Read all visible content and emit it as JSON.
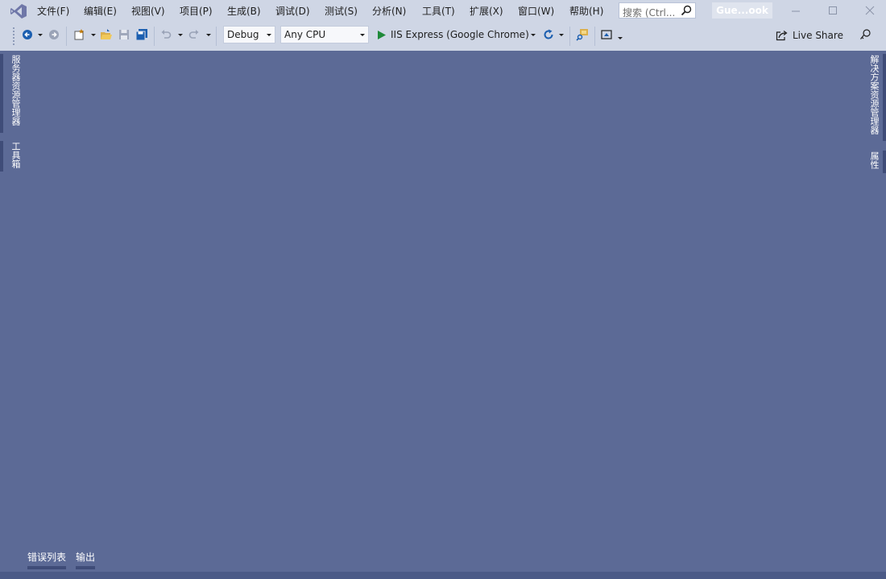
{
  "menu": {
    "items": [
      "文件(F)",
      "编辑(E)",
      "视图(V)",
      "项目(P)",
      "生成(B)",
      "调试(D)",
      "测试(S)",
      "分析(N)",
      "工具(T)",
      "扩展(X)",
      "窗口(W)",
      "帮助(H)"
    ]
  },
  "search": {
    "placeholder": "搜索 (Ctrl..."
  },
  "account": {
    "label": "Gue...ook"
  },
  "toolbar": {
    "configuration": "Debug",
    "platform": "Any CPU",
    "run_target": "IIS Express (Google Chrome)",
    "live_share": "Live Share"
  },
  "side_tabs": {
    "left": [
      "服务器资源管理器",
      "工具箱"
    ],
    "right": [
      "解决方案资源管理器",
      "属性"
    ]
  },
  "bottom_tabs": [
    "错误列表",
    "输出"
  ],
  "colors": {
    "chrome": "#cfd6e5",
    "workspace": "#5c6a96",
    "accent_vs": "#6c5fc7",
    "run_green": "#1f8a3a"
  }
}
